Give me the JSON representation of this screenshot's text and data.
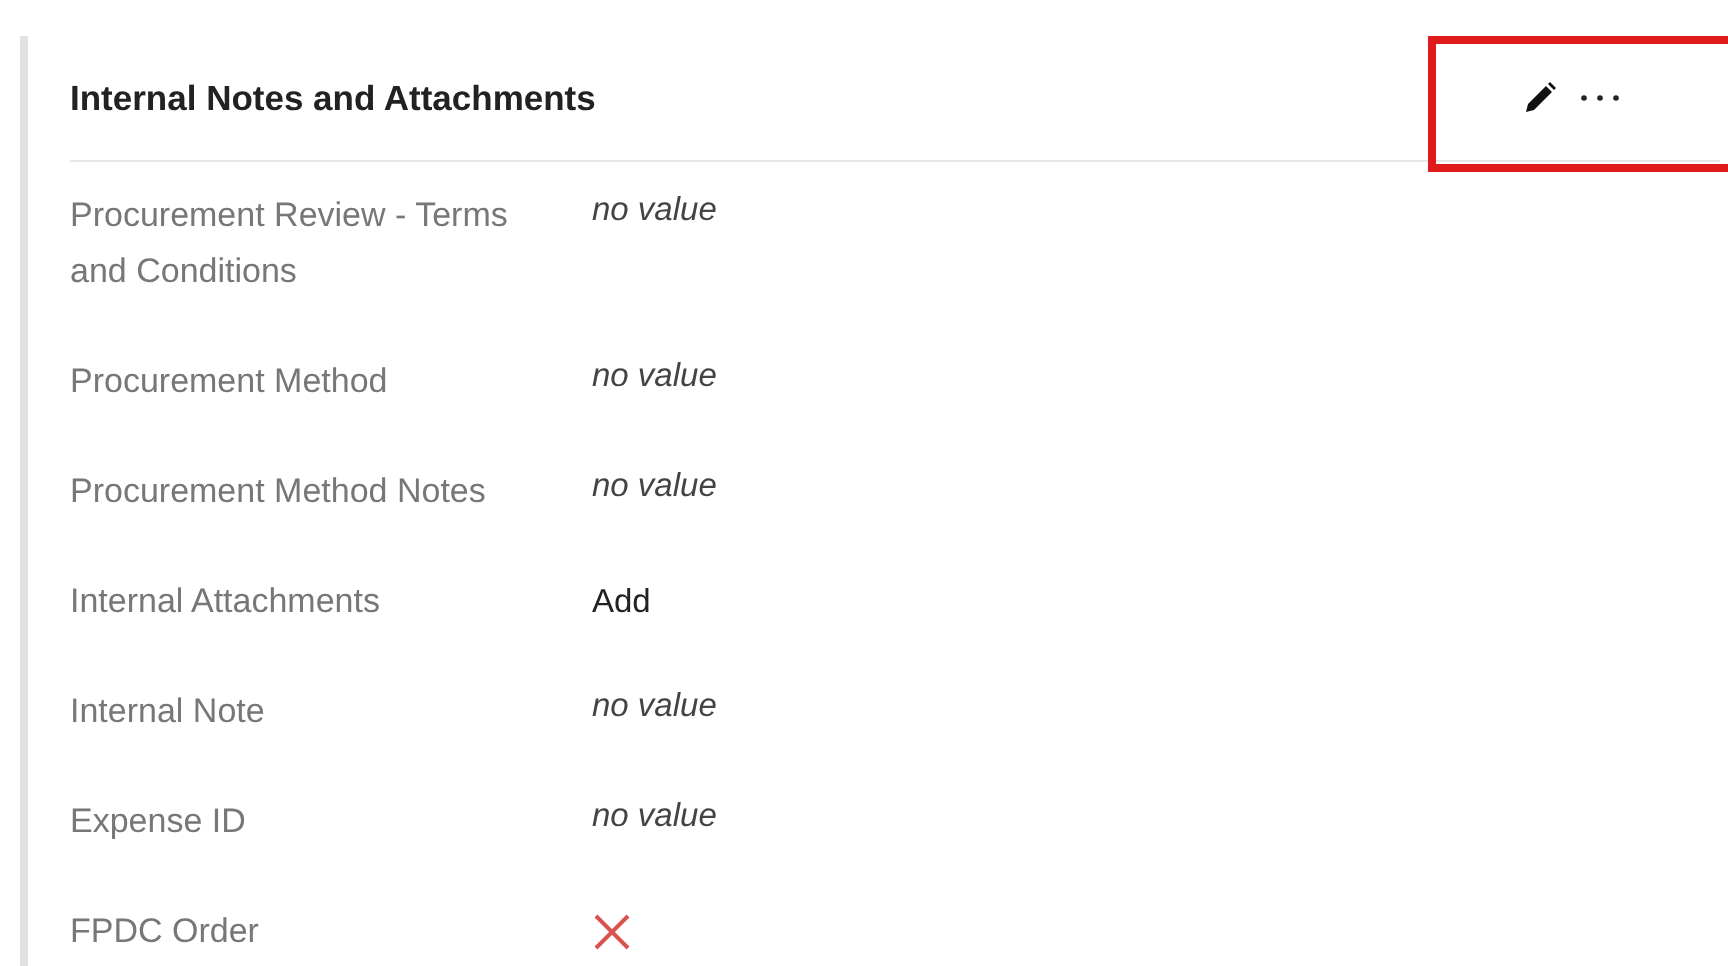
{
  "panel": {
    "title": "Internal Notes and Attachments",
    "highlighted": true
  },
  "fields": [
    {
      "label": "Procurement Review - Terms and Conditions",
      "kind": "empty",
      "value": "no value"
    },
    {
      "label": "Procurement Method",
      "kind": "empty",
      "value": "no value"
    },
    {
      "label": "Procurement Method Notes",
      "kind": "empty",
      "value": "no value"
    },
    {
      "label": "Internal Attachments",
      "kind": "link",
      "value": "Add"
    },
    {
      "label": "Internal Note",
      "kind": "empty",
      "value": "no value"
    },
    {
      "label": "Expense ID",
      "kind": "empty",
      "value": "no value"
    },
    {
      "label": "FPDC Order",
      "kind": "cross"
    }
  ]
}
